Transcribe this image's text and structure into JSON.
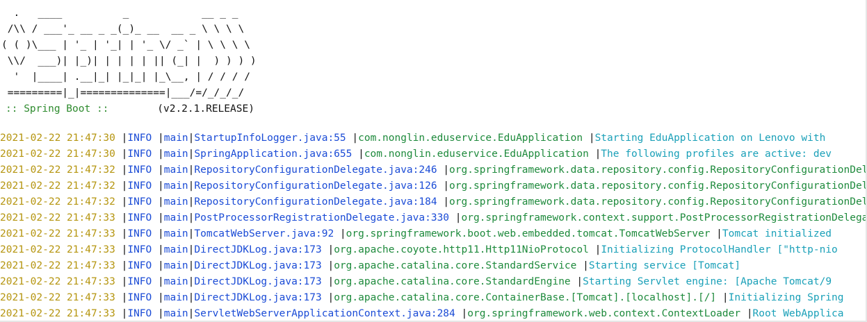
{
  "banner": {
    "ascii_lines": [
      "  .   ____          _            __ _ _",
      " /\\\\ / ___'_ __ _ _(_)_ __  __ _ \\ \\ \\ \\",
      "( ( )\\___ | '_ | '_| | '_ \\/ _` | \\ \\ \\ \\",
      " \\\\/  ___)| |_)| | | | | || (_| |  ) ) ) )",
      "  '  |____| .__|_| |_|_| |_\\__, | / / / /",
      " =========|_|==============|___/=/_/_/_/"
    ],
    "boot_label": ":: Spring Boot ::",
    "boot_version": "(v2.2.1.RELEASE)"
  },
  "log_rows": [
    {
      "timestamp": "2021-02-22 21:47:30",
      "level": "INFO ",
      "thread": "main",
      "source": "StartupInfoLogger.java:55 ",
      "class": "com.nonglin.eduservice.EduApplication ",
      "message": "Starting EduApplication on Lenovo with"
    },
    {
      "timestamp": "2021-02-22 21:47:30",
      "level": "INFO ",
      "thread": "main",
      "source": "SpringApplication.java:655 ",
      "class": "com.nonglin.eduservice.EduApplication ",
      "message": "The following profiles are active: dev"
    },
    {
      "timestamp": "2021-02-22 21:47:32",
      "level": "INFO ",
      "thread": "main",
      "source": "RepositoryConfigurationDelegate.java:246 ",
      "class": "org.springframework.data.repository.config.RepositoryConfigurationDelegate",
      "message": ""
    },
    {
      "timestamp": "2021-02-22 21:47:32",
      "level": "INFO ",
      "thread": "main",
      "source": "RepositoryConfigurationDelegate.java:126 ",
      "class": "org.springframework.data.repository.config.RepositoryConfigurationDelegate",
      "message": ""
    },
    {
      "timestamp": "2021-02-22 21:47:32",
      "level": "INFO ",
      "thread": "main",
      "source": "RepositoryConfigurationDelegate.java:184 ",
      "class": "org.springframework.data.repository.config.RepositoryConfigurationDelegate",
      "message": ""
    },
    {
      "timestamp": "2021-02-22 21:47:33",
      "level": "INFO ",
      "thread": "main",
      "source": "PostProcessorRegistrationDelegate.java:330 ",
      "class": "org.springframework.context.support.PostProcessorRegistrationDelegate",
      "message": ""
    },
    {
      "timestamp": "2021-02-22 21:47:33",
      "level": "INFO ",
      "thread": "main",
      "source": "TomcatWebServer.java:92 ",
      "class": "org.springframework.boot.web.embedded.tomcat.TomcatWebServer ",
      "message": "Tomcat initialized"
    },
    {
      "timestamp": "2021-02-22 21:47:33",
      "level": "INFO ",
      "thread": "main",
      "source": "DirectJDKLog.java:173 ",
      "class": "org.apache.coyote.http11.Http11NioProtocol ",
      "message": "Initializing ProtocolHandler [\"http-nio"
    },
    {
      "timestamp": "2021-02-22 21:47:33",
      "level": "INFO ",
      "thread": "main",
      "source": "DirectJDKLog.java:173 ",
      "class": "org.apache.catalina.core.StandardService ",
      "message": "Starting service [Tomcat]"
    },
    {
      "timestamp": "2021-02-22 21:47:33",
      "level": "INFO ",
      "thread": "main",
      "source": "DirectJDKLog.java:173 ",
      "class": "org.apache.catalina.core.StandardEngine ",
      "message": "Starting Servlet engine: [Apache Tomcat/9"
    },
    {
      "timestamp": "2021-02-22 21:47:33",
      "level": "INFO ",
      "thread": "main",
      "source": "DirectJDKLog.java:173 ",
      "class": "org.apache.catalina.core.ContainerBase.[Tomcat].[localhost].[/] ",
      "message": "Initializing Spring"
    },
    {
      "timestamp": "2021-02-22 21:47:33",
      "level": "INFO ",
      "thread": "main",
      "source": "ServletWebServerApplicationContext.java:284 ",
      "class": "org.springframework.web.context.ContextLoader ",
      "message": "Root WebApplica"
    }
  ],
  "separator": "|",
  "colors": {
    "timestamp": "#b5950f",
    "level": "#1a4bd6",
    "thread": "#1a4bd6",
    "source": "#1a4bd6",
    "class": "#1e8a3c",
    "message": "#1aa0b8",
    "boot_label": "#2e8b2e"
  }
}
